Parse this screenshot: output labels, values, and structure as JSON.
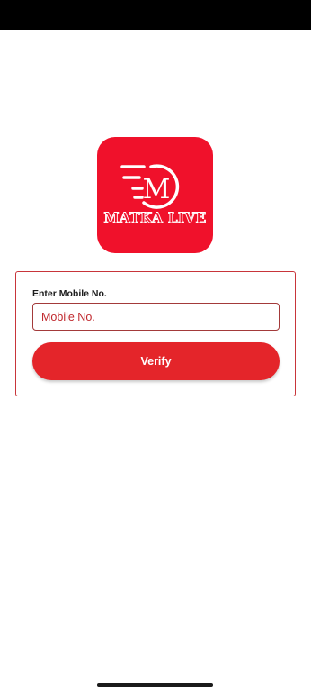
{
  "logo": {
    "icon": "matka-live-logo",
    "letter": "M",
    "brand_text": "MATKA LIVE",
    "background_color": "#f0112b"
  },
  "form": {
    "label": "Enter Mobile No.",
    "mobile_placeholder": "Mobile No.",
    "mobile_value": "",
    "verify_label": "Verify",
    "accent_color": "#e4252a"
  }
}
